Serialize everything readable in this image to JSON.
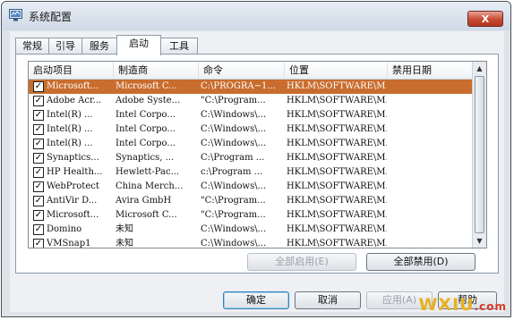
{
  "window": {
    "title": "系统配置",
    "close_glyph": "X"
  },
  "tabs": [
    "常规",
    "引导",
    "服务",
    "启动",
    "工具"
  ],
  "active_tab": 3,
  "startup_list": {
    "columns": [
      "启动项目",
      "制造商",
      "命令",
      "位置",
      "禁用日期"
    ],
    "rows": [
      {
        "name": "Microsoft...",
        "manufacturer": "Microsoft C...",
        "command": "C:\\PROGRA~1...",
        "location": "HKLM\\SOFTWARE\\M...",
        "date": "",
        "checked": true,
        "selected": true
      },
      {
        "name": "Adobe Acr...",
        "manufacturer": "Adobe Syste...",
        "command": "\"C:\\Program...",
        "location": "HKLM\\SOFTWARE\\M...",
        "date": "",
        "checked": true,
        "selected": false
      },
      {
        "name": "Intel(R) ...",
        "manufacturer": "Intel Corpo...",
        "command": "C:\\Windows\\...",
        "location": "HKLM\\SOFTWARE\\M...",
        "date": "",
        "checked": true,
        "selected": false
      },
      {
        "name": "Intel(R) ...",
        "manufacturer": "Intel Corpo...",
        "command": "C:\\Windows\\...",
        "location": "HKLM\\SOFTWARE\\M...",
        "date": "",
        "checked": true,
        "selected": false
      },
      {
        "name": "Intel(R) ...",
        "manufacturer": "Intel Corpo...",
        "command": "C:\\Windows\\...",
        "location": "HKLM\\SOFTWARE\\M...",
        "date": "",
        "checked": true,
        "selected": false
      },
      {
        "name": "Synaptics...",
        "manufacturer": "Synaptics, ...",
        "command": "C:\\Program ...",
        "location": "HKLM\\SOFTWARE\\M...",
        "date": "",
        "checked": true,
        "selected": false
      },
      {
        "name": "HP Health...",
        "manufacturer": "Hewlett-Pac...",
        "command": "c:\\Program ...",
        "location": "HKLM\\SOFTWARE\\M...",
        "date": "",
        "checked": true,
        "selected": false
      },
      {
        "name": "WebProtect",
        "manufacturer": "China Merch...",
        "command": "C:\\Windows\\...",
        "location": "HKLM\\SOFTWARE\\M...",
        "date": "",
        "checked": true,
        "selected": false
      },
      {
        "name": "AntiVir D...",
        "manufacturer": "Avira GmbH",
        "command": "\"C:\\Program...",
        "location": "HKLM\\SOFTWARE\\M...",
        "date": "",
        "checked": true,
        "selected": false
      },
      {
        "name": "Microsoft...",
        "manufacturer": "Microsoft C...",
        "command": "\"C:\\Program...",
        "location": "HKLM\\SOFTWARE\\M...",
        "date": "",
        "checked": true,
        "selected": false
      },
      {
        "name": "Domino",
        "manufacturer": "未知",
        "command": "C:\\Windows\\...",
        "location": "HKLM\\SOFTWARE\\M...",
        "date": "",
        "checked": true,
        "selected": false
      },
      {
        "name": "VMSnap1",
        "manufacturer": "未知",
        "command": "C:\\Windows\\...",
        "location": "HKLM\\SOFTWARE\\M...",
        "date": "",
        "checked": true,
        "selected": false
      }
    ],
    "check_glyph": "✓"
  },
  "panel_buttons": {
    "enable_all": "全部启用(E)",
    "disable_all": "全部禁用(D)"
  },
  "dialog_buttons": {
    "ok": "确定",
    "cancel": "取消",
    "apply": "应用(A)",
    "help": "帮助"
  },
  "watermark": {
    "text": "WXIU",
    "suffix": ".com"
  },
  "colors": {
    "selection": "#c86d2e",
    "close_button": "#c84a34",
    "watermark": "#e8b020"
  }
}
